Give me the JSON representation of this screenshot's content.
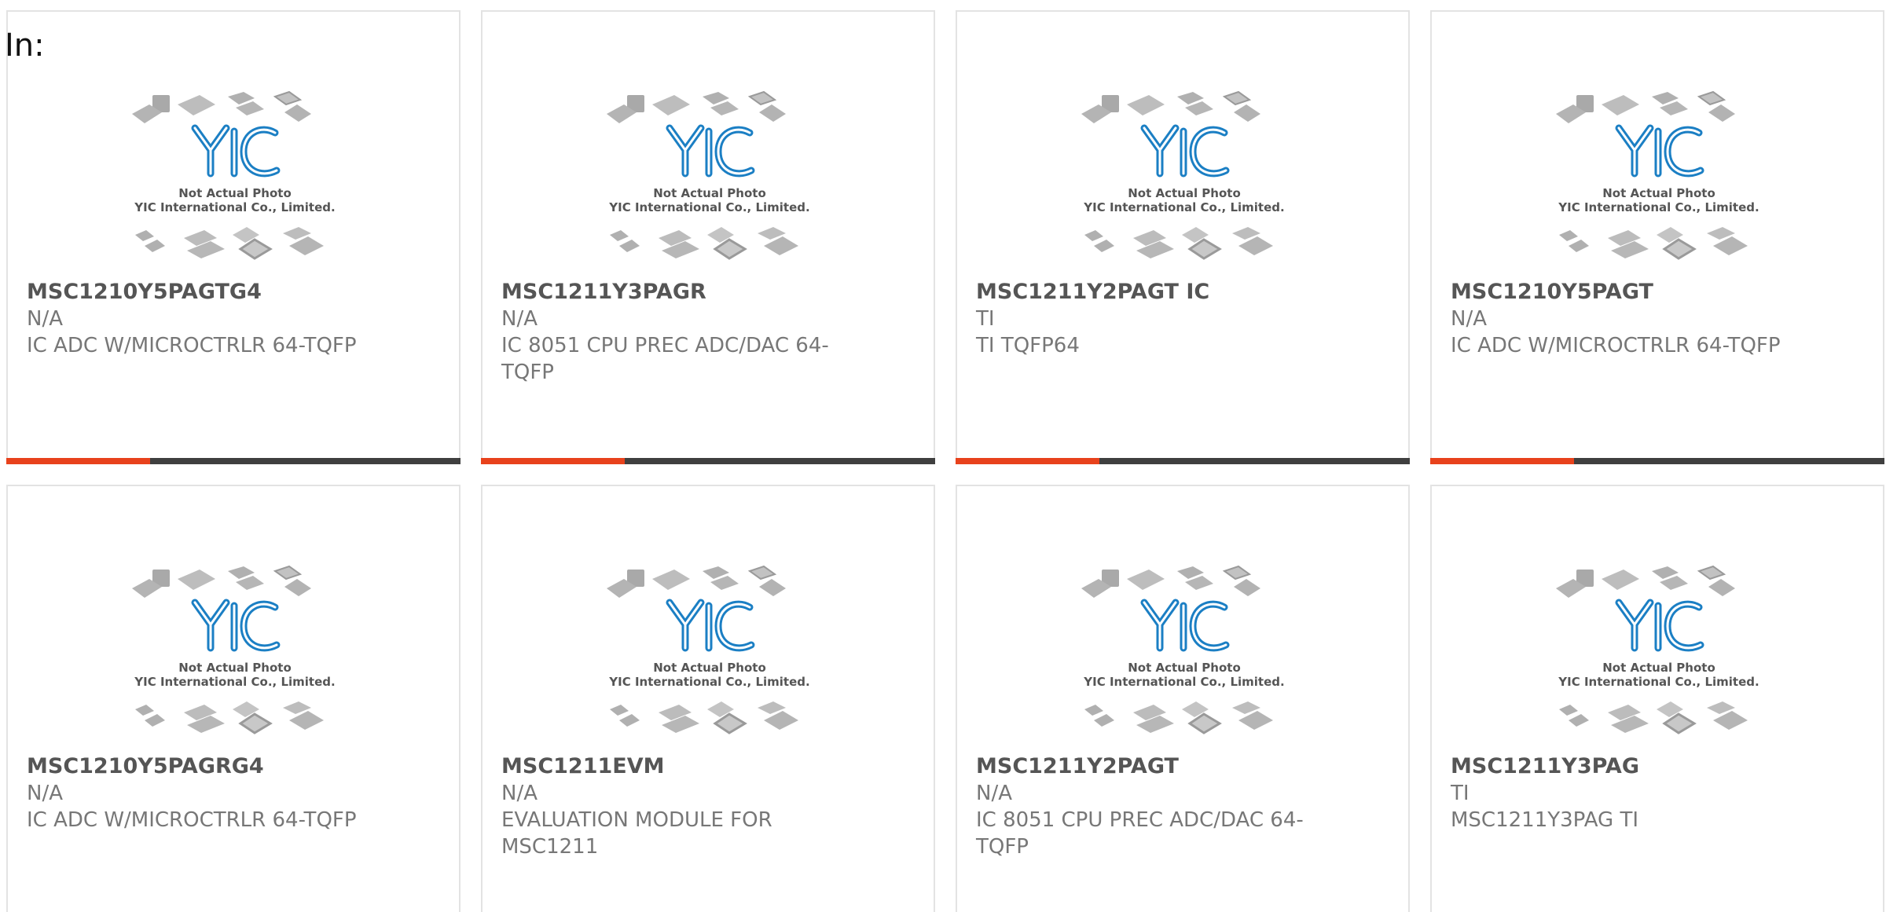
{
  "page": {
    "in_label": "In:",
    "accent_color": "#e8421c",
    "bar_color": "#3f3f3f",
    "logo_color": "#1b7fc4"
  },
  "placeholder": {
    "logo_text": "YIC",
    "line1": "Not Actual Photo",
    "line2": "YIC International Co., Limited."
  },
  "products": [
    {
      "part_number": "MSC1210Y5PAGTG4",
      "manufacturer": "N/A",
      "description": "IC ADC W/MICROCTRLR 64-TQFP",
      "show_bar": true
    },
    {
      "part_number": "MSC1211Y3PAGR",
      "manufacturer": "N/A",
      "description": "IC 8051 CPU PREC ADC/DAC 64-TQFP",
      "show_bar": true
    },
    {
      "part_number": "MSC1211Y2PAGT IC",
      "manufacturer": "TI",
      "description": "TI TQFP64",
      "show_bar": true
    },
    {
      "part_number": "MSC1210Y5PAGT",
      "manufacturer": "N/A",
      "description": "IC ADC W/MICROCTRLR 64-TQFP",
      "show_bar": true
    },
    {
      "part_number": "MSC1210Y5PAGRG4",
      "manufacturer": "N/A",
      "description": "IC ADC W/MICROCTRLR 64-TQFP",
      "show_bar": false
    },
    {
      "part_number": "MSC1211EVM",
      "manufacturer": "N/A",
      "description": "EVALUATION MODULE FOR MSC1211",
      "show_bar": false
    },
    {
      "part_number": "MSC1211Y2PAGT",
      "manufacturer": "N/A",
      "description": "IC 8051 CPU PREC ADC/DAC 64-TQFP",
      "show_bar": false
    },
    {
      "part_number": "MSC1211Y3PAG",
      "manufacturer": "TI",
      "description": "MSC1211Y3PAG TI",
      "show_bar": false
    }
  ]
}
